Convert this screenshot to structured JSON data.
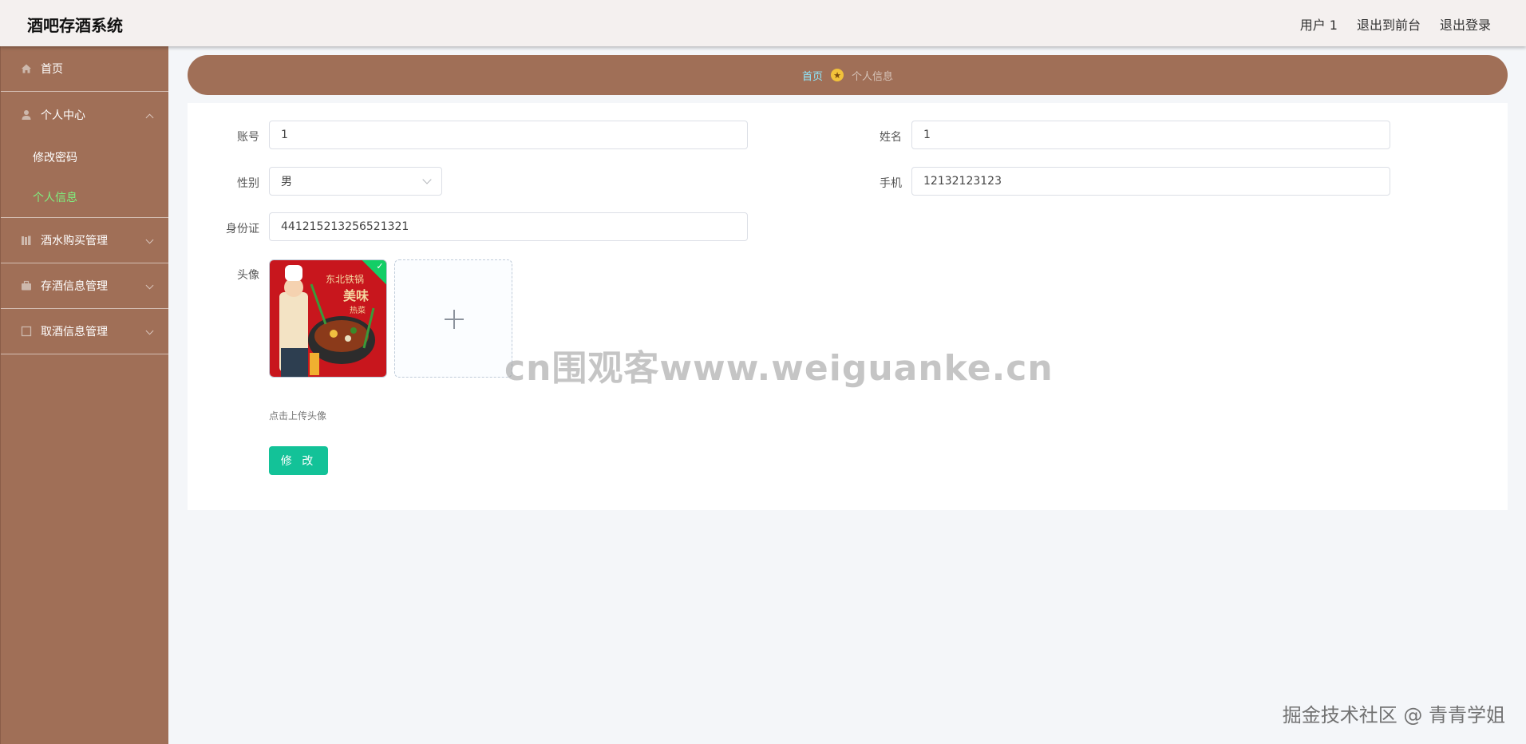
{
  "header": {
    "title": "酒吧存酒系统",
    "links": [
      "用户 1",
      "退出到前台",
      "退出登录"
    ]
  },
  "sidebar": {
    "items": [
      {
        "label": "首页",
        "icon": "home-icon"
      },
      {
        "label": "个人中心",
        "icon": "user-icon",
        "expanded": true,
        "children": [
          {
            "label": "修改密码"
          },
          {
            "label": "个人信息",
            "active": true
          }
        ]
      },
      {
        "label": "酒水购买管理",
        "icon": "books-icon"
      },
      {
        "label": "存酒信息管理",
        "icon": "briefcase-icon"
      },
      {
        "label": "取酒信息管理",
        "icon": "box-icon"
      }
    ]
  },
  "breadcrumb": {
    "home": "首页",
    "current": "个人信息"
  },
  "form": {
    "account_label": "账号",
    "account_value": "1",
    "name_label": "姓名",
    "name_value": "1",
    "gender_label": "性别",
    "gender_value": "男",
    "phone_label": "手机",
    "phone_value": "12132123123",
    "idcard_label": "身份证",
    "idcard_value": "441215213256521321",
    "avatar_label": "头像",
    "avatar_text_1": "东北铁锅",
    "avatar_text_2": "美味",
    "avatar_text_3": "热菜",
    "upload_tip": "点击上传头像",
    "submit_label": "修 改"
  },
  "watermarks": {
    "center": "cn围观客www.weiguanke.cn",
    "corner": "掘金技术社区 @ 青青学姐"
  },
  "colors": {
    "sidebar": "#a06f57",
    "active_submenu": "#7ff07f",
    "breadcrumb_home": "#8ee9ff",
    "submit": "#13c298"
  }
}
